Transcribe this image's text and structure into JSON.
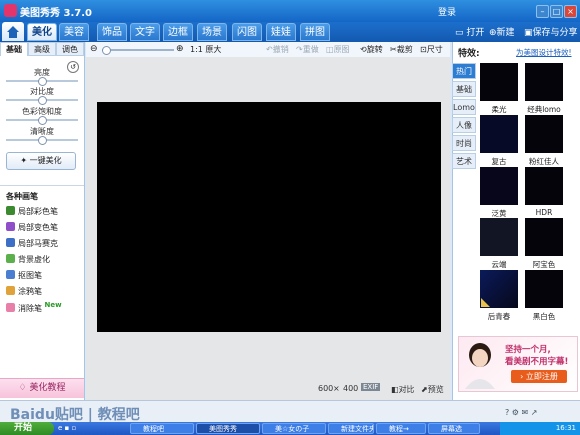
{
  "app": {
    "title": "美图秀秀 3.7.0",
    "login": "登录"
  },
  "menu": {
    "tabs": [
      "美化",
      "美容",
      "饰品",
      "文字",
      "边框",
      "场景",
      "闪图",
      "娃娃",
      "拼图"
    ],
    "active": "美化",
    "actions": {
      "open": "打开",
      "new": "新建",
      "save": "保存与分享"
    }
  },
  "left_panel": {
    "subtabs": [
      "基础",
      "高级",
      "调色"
    ],
    "adjustments": [
      {
        "label": "亮度",
        "value": 0.5
      },
      {
        "label": "对比度",
        "value": 0.5
      },
      {
        "label": "色彩饱和度",
        "value": 0.5
      },
      {
        "label": "清晰度",
        "value": 0.5
      }
    ],
    "one_key": "一键美化",
    "brush_title": "各种画笔",
    "brushes": [
      {
        "label": "局部彩色笔",
        "color": "#3b8a2f"
      },
      {
        "label": "局部变色笔",
        "color": "#8f4fc8"
      },
      {
        "label": "局部马赛克",
        "color": "#3d6fc7"
      },
      {
        "label": "背景虚化",
        "color": "#5bb04c"
      },
      {
        "label": "抠图笔",
        "color": "#4a7ed0"
      },
      {
        "label": "涂鸦笔",
        "color": "#e0a23a"
      },
      {
        "label": "消除笔",
        "color": "#e87fa8",
        "badge": "New"
      }
    ],
    "tutorial": "美化教程"
  },
  "toolbar": {
    "actual_size": "1:1 原大",
    "undo": "撤销",
    "redo": "重做",
    "original": "原图",
    "rotate": "旋转",
    "crop": "裁剪",
    "resize": "尺寸"
  },
  "status": {
    "width": "600",
    "times": "×",
    "height": "400",
    "exif": "EXIF",
    "compare": "对比",
    "preview": "预览"
  },
  "right_panel": {
    "title": "特效:",
    "link": "为美图设计特效!",
    "categories": [
      "热门",
      "基础",
      "Lomo",
      "人像",
      "时尚",
      "艺术"
    ],
    "active_category": "热门",
    "effects": [
      "柔光",
      "经典lomo",
      "复古",
      "粉红佳人",
      "泛黄",
      "HDR",
      "云端",
      "阿宝色",
      "后青春",
      "黑白色"
    ],
    "ad": {
      "line1": "坚持一个月,",
      "line2": "看美剧不用字幕!",
      "cta": "立即注册"
    }
  },
  "watermark": "Baidu贴吧 | 教程吧",
  "taskbar": {
    "start": "开始",
    "tasks": [
      "教程吧",
      "美图秀秀",
      "美☆女の子",
      "新建文件夹",
      "教程→",
      "屏幕选"
    ],
    "active_task": "美图秀秀",
    "time": "16:31"
  }
}
